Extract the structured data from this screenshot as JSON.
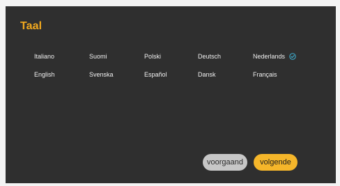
{
  "title": "Taal",
  "languages": [
    {
      "label": "Italiano"
    },
    {
      "label": "Suomi"
    },
    {
      "label": "Polski"
    },
    {
      "label": "Deutsch"
    },
    {
      "label": "Nederlands",
      "selected": true
    },
    {
      "label": "English"
    },
    {
      "label": "Svenska"
    },
    {
      "label": "Español"
    },
    {
      "label": "Dansk"
    },
    {
      "label": "Français"
    }
  ],
  "selected_language": "Nederlands",
  "buttons": {
    "previous_label": "voorgaand",
    "next_label": "volgende"
  },
  "colors": {
    "accent": "#f2a91e",
    "check": "#3fb3d6",
    "background": "#2f2f2f"
  },
  "icons": {
    "selected_indicator": "check-circle-icon"
  }
}
